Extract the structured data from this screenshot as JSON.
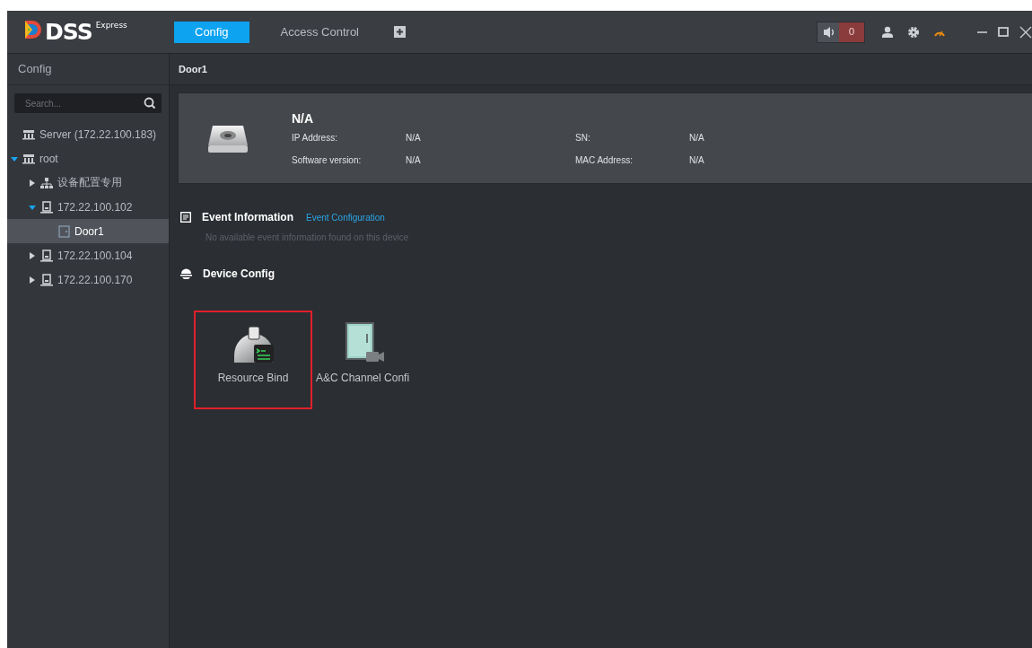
{
  "app": {
    "logo_text": "DSS",
    "logo_edition": "Express"
  },
  "tabs": [
    {
      "label": "Config",
      "selected": true
    },
    {
      "label": "Access Control",
      "selected": false
    }
  ],
  "alarm": {
    "count": "0"
  },
  "sidebar": {
    "title": "Config",
    "search": {
      "placeholder": "Search..."
    },
    "tree": [
      {
        "label": "Server (172.22.100.183)",
        "kind": "server",
        "selected": false
      },
      {
        "label": "root",
        "kind": "server",
        "expanded": true,
        "selected": false,
        "children": [
          {
            "label": "设备配置专用",
            "kind": "org",
            "expanded": false,
            "selected": false
          },
          {
            "label": "172.22.100.102",
            "kind": "device",
            "expanded": true,
            "selected": false,
            "children": [
              {
                "label": "Door1",
                "kind": "door",
                "selected": true
              }
            ]
          },
          {
            "label": "172.22.100.104",
            "kind": "device",
            "expanded": false,
            "selected": false
          },
          {
            "label": "172.22.100.170",
            "kind": "device",
            "expanded": false,
            "selected": false
          }
        ]
      }
    ]
  },
  "breadcrumb": "Door1",
  "device": {
    "name": "N/A",
    "fields": [
      {
        "label": "IP Address:",
        "value": "N/A"
      },
      {
        "label": "SN:",
        "value": "N/A"
      },
      {
        "label": "Software version:",
        "value": "N/A"
      },
      {
        "label": "MAC Address:",
        "value": "N/A"
      }
    ]
  },
  "event_section": {
    "title": "Event Information",
    "link": "Event Configuration",
    "message": "No available event information found on this device"
  },
  "config_section": {
    "title": "Device Config",
    "tiles": [
      {
        "label": "Resource Bind",
        "kind": "resource",
        "selected": true
      },
      {
        "label": "A&C Channel Confi",
        "kind": "channel",
        "selected": false
      }
    ]
  }
}
